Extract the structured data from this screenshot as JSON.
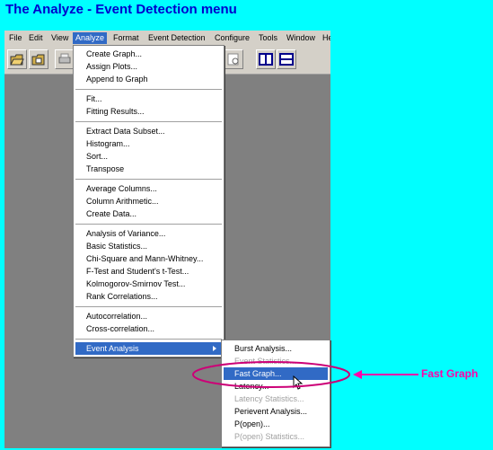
{
  "page_title": "The Analyze - Event Detection menu",
  "menubar": [
    "File",
    "Edit",
    "View",
    "Analyze",
    "Format",
    "Event Detection",
    "Configure",
    "Tools",
    "Window",
    "He"
  ],
  "analyze_menu": {
    "groups": [
      [
        "Create Graph...",
        "Assign Plots...",
        "Append to Graph"
      ],
      [
        "Fit...",
        "Fitting Results..."
      ],
      [
        "Extract Data Subset...",
        "Histogram...",
        "Sort...",
        "Transpose"
      ],
      [
        "Average Columns...",
        "Column Arithmetic...",
        "Create Data..."
      ],
      [
        "Analysis of Variance...",
        "Basic Statistics...",
        "Chi-Square and Mann-Whitney...",
        "F-Test and Student's t-Test...",
        "Kolmogorov-Smirnov Test...",
        "Rank Correlations..."
      ],
      [
        "Autocorrelation...",
        "Cross-correlation..."
      ],
      [
        "Event Analysis"
      ]
    ]
  },
  "event_submenu": [
    {
      "label": "Burst Analysis...",
      "state": "normal"
    },
    {
      "label": "Event Statistics...",
      "state": "disabled"
    },
    {
      "label": "Fast Graph...",
      "state": "selected"
    },
    {
      "label": "Latency...",
      "state": "normal"
    },
    {
      "label": "Latency Statistics...",
      "state": "disabled"
    },
    {
      "label": "Perievent Analysis...",
      "state": "normal"
    },
    {
      "label": "P(open)...",
      "state": "normal"
    },
    {
      "label": "P(open) Statistics...",
      "state": "disabled"
    }
  ],
  "annotation": {
    "label": "Fast Graph",
    "color": "#ff00aa"
  },
  "colors": {
    "background": "#00ffff",
    "title": "#0000cc",
    "highlight": "#316ac5"
  },
  "icons": [
    "open-folder-icon",
    "save-folder-icon",
    "print-icon",
    "layout-icon",
    "split-vertical-icon",
    "split-horizontal-icon"
  ]
}
